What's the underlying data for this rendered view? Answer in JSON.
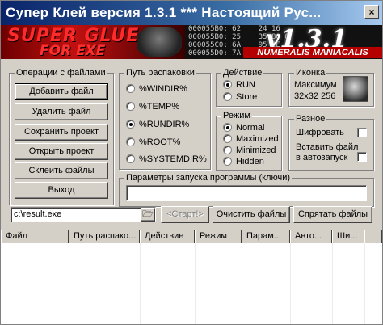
{
  "window": {
    "title": "Супер Клей версия 1.3.1 ***  Настоящий Рус...",
    "close_glyph": "×"
  },
  "banner": {
    "logo_line1": "SUPER GLUE",
    "logo_line2": "FOR EXE",
    "version": "v1.3.1",
    "subtitle": "NUMERALIS MANIACALIS",
    "hex_dump": "000055B0: 62    24 16\n000055B0: 25    35 80 6\n000055C0: 6A    95 2E 6\n000055D0: 7A    22 8A 2"
  },
  "file_ops": {
    "title": "Операции с файлами",
    "add": "Добавить файл",
    "delete": "Удалить файл",
    "save_project": "Сохранить проект",
    "open_project": "Открыть проект",
    "glue": "Склеить файлы",
    "exit": "Выход"
  },
  "unpack_path": {
    "title": "Путь распаковки",
    "options": [
      "%WINDIR%",
      "%TEMP%",
      "%RUNDIR%",
      "%ROOT%",
      "%SYSTEMDIR%"
    ],
    "selected": "%RUNDIR%"
  },
  "action": {
    "title": "Действие",
    "options": [
      "RUN",
      "Store"
    ],
    "selected": "RUN"
  },
  "icon": {
    "title": "Иконка",
    "name": "Максимум",
    "size": "32x32 256",
    "icon_name": "wolf-icon"
  },
  "mode": {
    "title": "Режим",
    "options": [
      "Normal",
      "Maximized",
      "Minimized",
      "Hidden"
    ],
    "selected": "Normal"
  },
  "misc": {
    "title": "Разное",
    "encrypt": "Шифровать",
    "autorun_line1": "Вставить файл",
    "autorun_line2": "в автозапуск"
  },
  "params": {
    "title": "Параметры запуска программы (ключи)",
    "value": ""
  },
  "output": {
    "path": "c:\\result.exe",
    "start": "<Старт!>",
    "clear": "Очистить файлы",
    "hide": "Спрятать файлы"
  },
  "table": {
    "columns": [
      "Файл",
      "Путь распако...",
      "Действие",
      "Режим",
      "Парам...",
      "Авто...",
      "Ши..."
    ]
  }
}
